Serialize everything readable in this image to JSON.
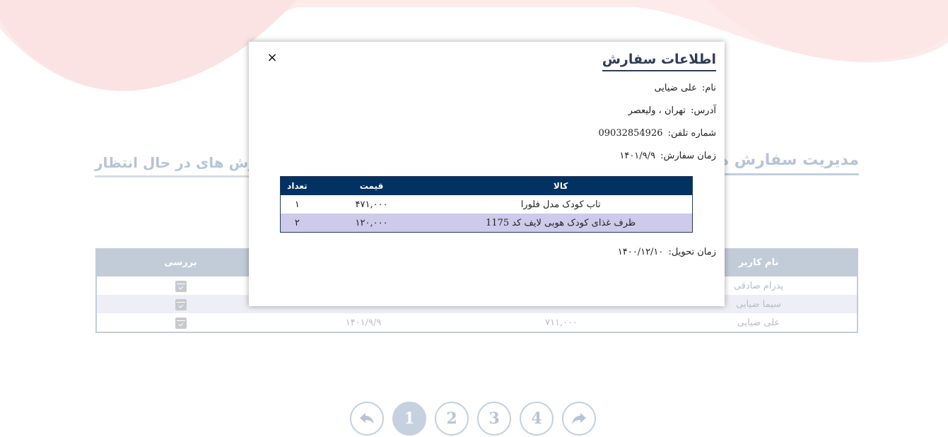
{
  "page": {
    "tab_manage": "مدیریت سفارش ها",
    "tab_pending": "سفارش های در حال انتظار"
  },
  "orders": {
    "headers": {
      "user": "نام کاربر",
      "review": "بررسی"
    },
    "rows": [
      {
        "user": "پدرام صادقی",
        "price": "",
        "date": ""
      },
      {
        "user": "سیما ضیایی",
        "price": "",
        "date": ""
      },
      {
        "user": "علی ضیایی",
        "price": "۷۱۱,۰۰۰",
        "date": "۱۴۰۱/۹/۹"
      }
    ]
  },
  "pagination": {
    "pages": [
      "1",
      "2",
      "3",
      "4"
    ],
    "current": "1",
    "prev_icon": "arrow-back-icon",
    "next_icon": "arrow-forward-icon"
  },
  "modal": {
    "title": "اطلاعات سفارش",
    "close_label": "×",
    "name_label": "نام:",
    "name_value": "علی ضیایی",
    "address_label": "آدرس:",
    "address_value": "تهران ، ولیعصر",
    "phone_label": "شماره تلفن:",
    "phone_value": "09032854926",
    "order_time_label": "زمان سفارش:",
    "order_time_value": "۱۴۰۱/۹/۹",
    "delivery_time_label": "زمان تحویل:",
    "delivery_time_value": "۱۴۰۰/۱۲/۱۰",
    "items_headers": {
      "name": "کالا",
      "price": "قیمت",
      "qty": "تعداد"
    },
    "items": [
      {
        "name": "تاب کودک مدل فلورا",
        "price": "۴۷۱,۰۰۰",
        "qty": "۱"
      },
      {
        "name": "ظرف غذای کودک هوبی لایف کد 1175",
        "price": "۱۲۰,۰۰۰",
        "qty": "۲"
      }
    ]
  },
  "colors": {
    "modal_header_bg": "#023262",
    "modal_alt_row": "#cdcaec",
    "faded_header_bg": "#c2ccd9",
    "title_color": "#2f3d55"
  }
}
